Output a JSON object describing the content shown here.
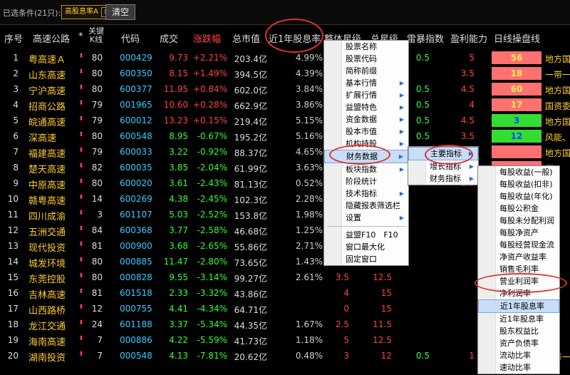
{
  "filter": {
    "label": "已选条件(21只):",
    "chip": "高股息率A",
    "chip_close": "×",
    "clear_btn": "清空"
  },
  "header": {
    "idx": "序号",
    "name": "高速公路",
    "star": "*",
    "kline1": "关键",
    "kline2": "K线",
    "code": "代码",
    "price": "成交",
    "change": "涨跌幅",
    "mcap": "总市值",
    "dividend": "近1年股息率",
    "overall": "整体星级",
    "total_star": "总星级",
    "thunder": "雷暴指数",
    "profit": "盈利能力",
    "daily": "日线操盘线"
  },
  "rows": [
    {
      "idx": "1",
      "name": "粤高速Ａ",
      "star": "⬍",
      "k": "80",
      "code": "000429",
      "price": "9.73",
      "change": "+2.21%",
      "mcap": "203.4亿",
      "div": "4.99%",
      "zt": "",
      "zx": "1",
      "lb": "0.5",
      "yl": "5",
      "score": "56",
      "score_bg": "#ff7070",
      "score_fg": "#ffee55",
      "sector": "地方国"
    },
    {
      "idx": "2",
      "name": "山东高速",
      "star": "⬍",
      "k": "80",
      "code": "600350",
      "price": "8.15",
      "change": "+1.49%",
      "mcap": "394.5亿",
      "div": "4.39%",
      "zt": "",
      "zx": "1",
      "lb": "",
      "yl": "3.5",
      "score": "18",
      "score_bg": "#ff7070",
      "score_fg": "#ffee55",
      "sector": "一带一"
    },
    {
      "idx": "3",
      "name": "宁沪高速",
      "star": "⬍",
      "k": "80",
      "code": "600377",
      "price": "11.95",
      "change": "+0.84%",
      "mcap": "602.0亿",
      "div": "3.84%",
      "zt": "",
      "zx": "5",
      "lb": "0.5",
      "yl": "4.5",
      "score": "60",
      "score_bg": "#ff7070",
      "score_fg": "#ffee55",
      "sector": "地方国"
    },
    {
      "idx": "4",
      "name": "招商公路",
      "star": "⬍",
      "k": "79",
      "code": "001965",
      "price": "10.60",
      "change": "+0.28%",
      "mcap": "662.9亿",
      "div": "3.86%",
      "zt": "",
      "zx": "5",
      "lb": "0.5",
      "yl": "4",
      "score": "17",
      "score_bg": "#ff7070",
      "score_fg": "#ffee55",
      "sector": "国资委"
    },
    {
      "idx": "5",
      "name": "皖通高速",
      "star": "⬍",
      "k": "79",
      "code": "600012",
      "price": "13.23",
      "change": "+0.15%",
      "mcap": "219.4亿",
      "div": "5.15%",
      "zt": "",
      "zx": "5",
      "lb": "0.5",
      "yl": "4.5",
      "score": "3",
      "score_bg": "#33dd33",
      "score_fg": "#1144ff",
      "sector": "地方国"
    },
    {
      "idx": "6",
      "name": "深高速",
      "star": "⬍",
      "k": "80",
      "code": "600548",
      "price": "8.95",
      "change": "-0.67%",
      "mcap": "195.2亿",
      "div": "5.16%",
      "zt": "",
      "zx": "5",
      "lb": "0.5",
      "yl": "3.5",
      "score": "12",
      "score_bg": "#33dd33",
      "score_fg": "#1144ff",
      "sector": "风能、"
    },
    {
      "idx": "7",
      "name": "福建高速",
      "star": "⬍",
      "k": "79",
      "code": "600033",
      "price": "3.22",
      "change": "-0.92%",
      "mcap": "88.37亿",
      "div": "4.65%",
      "zt": "",
      "zx": "",
      "lb": "",
      "yl": "",
      "score": "",
      "score_bg": "#ff7070",
      "score_fg": "#ffee55",
      "sector": "地方国"
    },
    {
      "idx": "8",
      "name": "楚天高速",
      "star": "⬍",
      "k": "82",
      "code": "600035",
      "price": "3.85",
      "change": "-2.04%",
      "mcap": "61.99亿",
      "div": "3.63%",
      "zt": "",
      "zx": "",
      "lb": "",
      "yl": "",
      "score": "",
      "score_bg": "#ff7070",
      "score_fg": "#ffee55",
      "sector": "概"
    },
    {
      "idx": "9",
      "name": "中原高速",
      "star": "⬍",
      "k": "80",
      "code": "600020",
      "price": "3.61",
      "change": "-2.43%",
      "mcap": "81.13亿",
      "div": "0.52%",
      "zt": "",
      "zx": "",
      "lb": "",
      "yl": "2.5",
      "score": "",
      "score_bg": "#ff7070",
      "score_fg": "#ffee55",
      "sector": "地"
    },
    {
      "idx": "10",
      "name": "赣粤高速",
      "star": "⬍",
      "k": "14",
      "code": "600269",
      "price": "4.38",
      "change": "-2.45%",
      "mcap": "102.3亿",
      "div": "2.28%",
      "zt": "",
      "zx": "",
      "lb": "",
      "yl": "",
      "score": "",
      "score_bg": "#ff7070",
      "score_fg": "#ffee55",
      "sector": "地"
    },
    {
      "idx": "11",
      "name": "四川成渝",
      "star": "⬍",
      "k": "3",
      "code": "601107",
      "price": "5.03",
      "change": "-2.52%",
      "mcap": "153.8亿",
      "div": "1.98%",
      "zt": "",
      "zx": "",
      "lb": "",
      "yl": "",
      "score": "",
      "score_bg": "#ff7070",
      "score_fg": "#ffee55",
      "sector": "地"
    },
    {
      "idx": "12",
      "name": "五洲交通",
      "star": "⬍",
      "k": "84",
      "code": "600368",
      "price": "3.77",
      "change": "-2.58%",
      "mcap": "46.68亿",
      "div": "1.25%",
      "zt": "",
      "zx": "",
      "lb": "",
      "yl": "",
      "score": "",
      "score_bg": "#ff7070",
      "score_fg": "#ffee55",
      "sector": "一"
    },
    {
      "idx": "13",
      "name": "现代投资",
      "star": "⬍",
      "k": "81",
      "code": "000900",
      "price": "3.68",
      "change": "-2.65%",
      "mcap": "55.86亿",
      "div": "2.71%",
      "zt": "",
      "zx": "",
      "lb": "",
      "yl": "",
      "score": "",
      "score_bg": "#ff7070",
      "score_fg": "#ffee55",
      "sector": "一"
    },
    {
      "idx": "14",
      "name": "城发环境",
      "star": "⬍",
      "k": "80",
      "code": "000885",
      "price": "11.47",
      "change": "-2.80%",
      "mcap": "73.65亿",
      "div": "1.43%",
      "zt": "5",
      "zx": "17.5",
      "lb": "",
      "yl": "",
      "score": "",
      "score_bg": "#ff7070",
      "score_fg": "#ffee55",
      "sector": "地"
    },
    {
      "idx": "15",
      "name": "东莞控股",
      "star": "⬍",
      "k": "80",
      "code": "000828",
      "price": "9.55",
      "change": "-3.14%",
      "mcap": "99.27亿",
      "div": "2.61%",
      "zt": "3.5",
      "zx": "12.5",
      "lb": "",
      "yl": "",
      "score": "",
      "score_bg": "#ff7070",
      "score_fg": "#ffee55",
      "sector": "地"
    },
    {
      "idx": "16",
      "name": "吉林高速",
      "star": "⬍",
      "k": "81",
      "code": "601518",
      "price": "2.33",
      "change": "-3.32%",
      "mcap": "43.86亿",
      "div": "",
      "zt": "4",
      "zx": "15",
      "lb": "",
      "yl": "",
      "score": "",
      "score_bg": "#ff7070",
      "score_fg": "#ffee55",
      "sector": "地"
    },
    {
      "idx": "17",
      "name": "山西路桥",
      "star": "⬍",
      "k": "12",
      "code": "000755",
      "price": "4.41",
      "change": "-4.34%",
      "mcap": "64.71亿",
      "div": "",
      "zt": "0",
      "zx": "15",
      "lb": "",
      "yl": "",
      "score": "",
      "score_bg": "#ff7070",
      "score_fg": "#ffee55",
      "sector": "地"
    },
    {
      "idx": "18",
      "name": "龙江交通",
      "star": "⬍",
      "k": "24",
      "code": "601188",
      "price": "3.37",
      "change": "-5.34%",
      "mcap": "44.35亿",
      "div": "1.67%",
      "zt": "2.5",
      "zx": "11.5",
      "lb": "",
      "yl": "",
      "score": "",
      "score_bg": "#ff7070",
      "score_fg": "#ffee55",
      "sector": "地"
    },
    {
      "idx": "19",
      "name": "海南高速",
      "star": "⬍",
      "k": "7",
      "code": "000886",
      "price": "4.22",
      "change": "-5.59%",
      "mcap": "41.73亿",
      "div": "1.18%",
      "zt": "5",
      "zx": "12.5",
      "lb": "",
      "yl": "",
      "score": "",
      "score_bg": "#ff7070",
      "score_fg": "#ffee55",
      "sector": "地"
    },
    {
      "idx": "20",
      "name": "湖南投资",
      "star": "⬍",
      "k": "7",
      "code": "000548",
      "price": "4.13",
      "change": "-7.81%",
      "mcap": "20.62亿",
      "div": "0.48%",
      "zt": "3",
      "zx": "12",
      "lb": "0.5",
      "yl": "1",
      "score": "8",
      "score_bg": "#ff7070",
      "score_fg": "#ffee55",
      "sector": "一带一"
    }
  ],
  "menu1": [
    {
      "label": "股票名称",
      "arrow": false
    },
    {
      "label": "股票代码",
      "arrow": false
    },
    {
      "label": "简称前缀",
      "arrow": false
    },
    {
      "label": "基本行情",
      "arrow": true
    },
    {
      "label": "扩展行情",
      "arrow": true
    },
    {
      "label": "益盟特色",
      "arrow": true
    },
    {
      "label": "资金数据",
      "arrow": true
    },
    {
      "label": "股本市值",
      "arrow": true
    },
    {
      "label": "机构持股",
      "arrow": true
    },
    {
      "label": "财务数据",
      "arrow": true,
      "hl": true
    },
    {
      "label": "板块指数",
      "arrow": true
    },
    {
      "label": "阶段统计",
      "arrow": false
    },
    {
      "label": "技术指标",
      "arrow": true
    },
    {
      "label": "隐藏报表筛选栏",
      "arrow": false
    },
    {
      "label": "设置",
      "arrow": true
    },
    {
      "sep": true
    },
    {
      "label": "益盟F10　F10",
      "arrow": false
    },
    {
      "label": "窗口最大化",
      "arrow": false
    },
    {
      "label": "固定窗口",
      "arrow": false
    }
  ],
  "menu2": [
    {
      "label": "主要指标",
      "arrow": true,
      "hl": true
    },
    {
      "label": "增长指标",
      "arrow": true
    },
    {
      "label": "财务指标",
      "arrow": true
    }
  ],
  "menu3": [
    {
      "label": "每股收益(一般)"
    },
    {
      "label": "每股收益(扣非)"
    },
    {
      "label": "每股收益(年化)"
    },
    {
      "label": "每股公积金"
    },
    {
      "label": "每股未分配利润"
    },
    {
      "label": "每股净资产"
    },
    {
      "label": "每股经营现金流"
    },
    {
      "label": "净资产收益率"
    },
    {
      "label": "销售毛利率"
    },
    {
      "label": "营业利润率"
    },
    {
      "label": "净利润率"
    },
    {
      "label": "近1年股息率",
      "hl": true
    },
    {
      "label": "近1年股息率"
    },
    {
      "label": "股东权益比"
    },
    {
      "label": "资产负债率"
    },
    {
      "label": "流动比率"
    },
    {
      "label": "速动比率"
    }
  ]
}
